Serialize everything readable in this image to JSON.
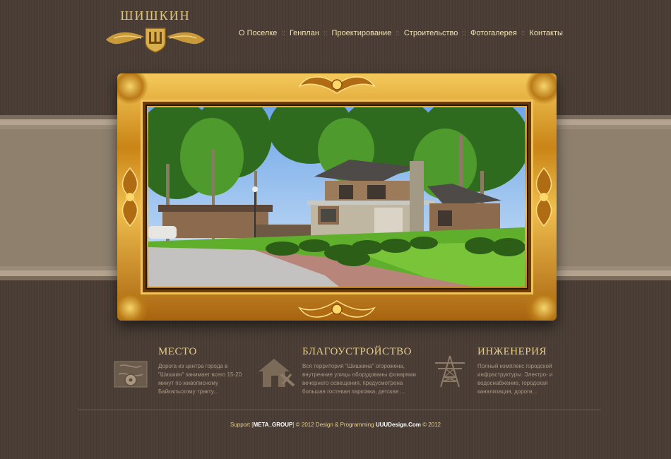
{
  "logo": {
    "text": "ШИШКИН"
  },
  "nav": {
    "items": [
      "О Поселке",
      "Генплан",
      "Проектирование",
      "Строительство",
      "Фотогалерея",
      "Контакты"
    ],
    "separator": "::"
  },
  "hero": {
    "image_alt": ""
  },
  "features": [
    {
      "title": "МЕСТО",
      "icon": "location-compass-icon",
      "text": "Дорога из центра города в \"Шишкин\" занимает всего 15-20 минут по живописному Байкальскому тракту..."
    },
    {
      "title": "БЛАГОУСТРОЙСТВО",
      "icon": "house-tools-icon",
      "text": "Вся территория \"Шишкина\" огорожена, внутренние улицы оборудованы фонарями вечернего освещения, предусмотрена большая гостевая парковка, детская ..."
    },
    {
      "title": "ИНЖЕНЕРИЯ",
      "icon": "power-tower-icon",
      "text": "Полный комплекс городской инфраструктуры. Электро- и водоснабжение, городская канализация, дороги..."
    }
  ],
  "footer": {
    "support_prefix": "Support [",
    "support_name": "META_GROUP",
    "support_suffix": "] © 2012 Design & Programming ",
    "design_name": "UUUDesign.Com",
    "design_suffix": " © 2012"
  },
  "colors": {
    "background": "#4a3e35",
    "band": "#9a8b79",
    "gold": "#e7cd8a",
    "nav_text": "#f1e2b4"
  }
}
